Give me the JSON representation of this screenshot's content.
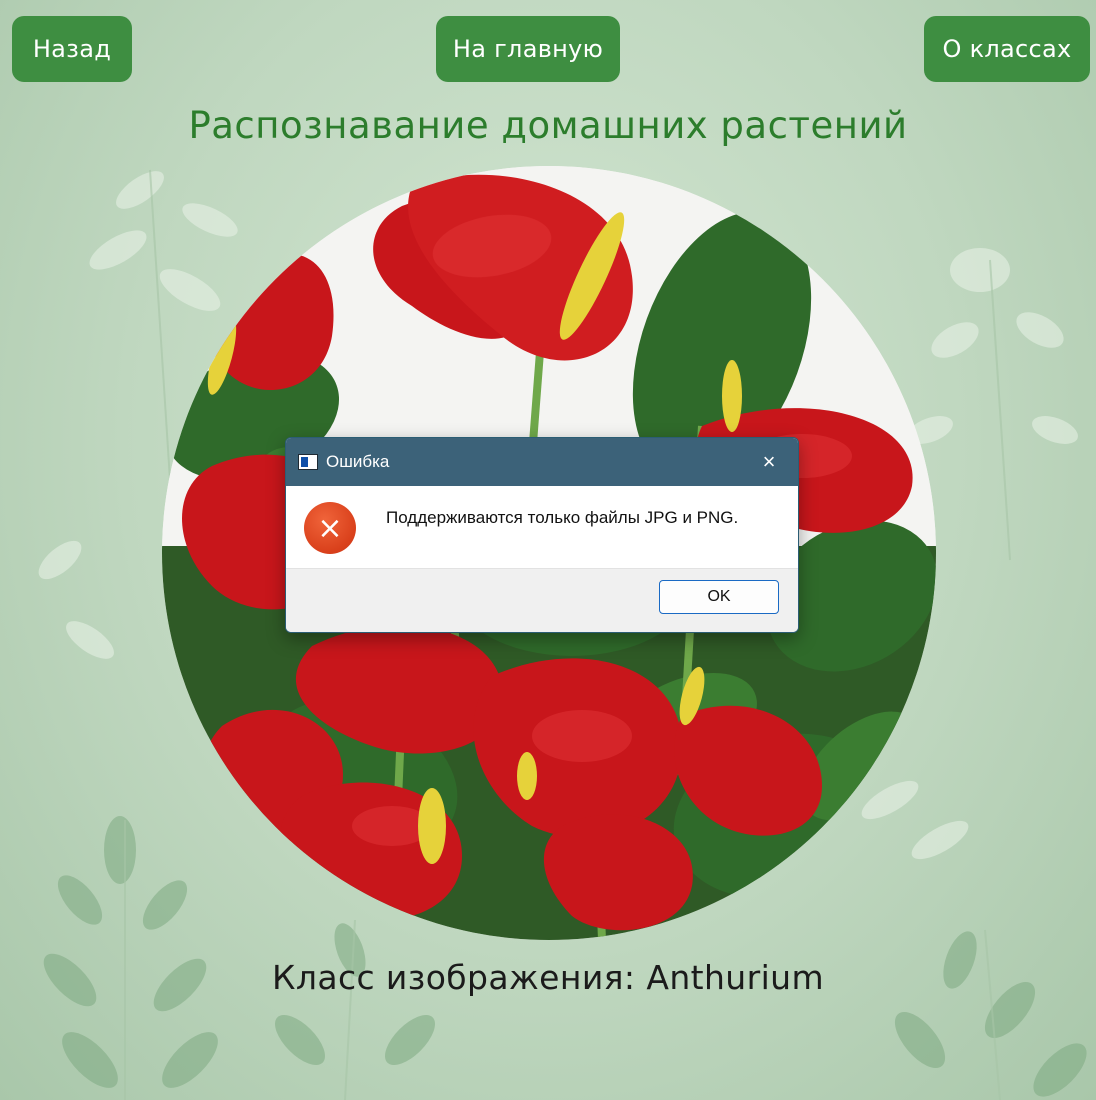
{
  "nav": {
    "back_label": "Назад",
    "home_label": "На главную",
    "classes_label": "О классах"
  },
  "page": {
    "title": "Распознавание домашних растений",
    "result_text": "Класс изображения: Anthurium"
  },
  "dialog": {
    "title": "Ошибка",
    "message": "Поддерживаются только файлы JPG и PNG.",
    "ok_label": "OK",
    "close_icon": "×",
    "error_icon": "×"
  },
  "colors": {
    "nav_button": "#3e8e41",
    "title": "#2c7d2c",
    "dialog_titlebar": "#3c6279",
    "error_icon": "#d9401b",
    "ok_border": "#1a6ac4"
  }
}
